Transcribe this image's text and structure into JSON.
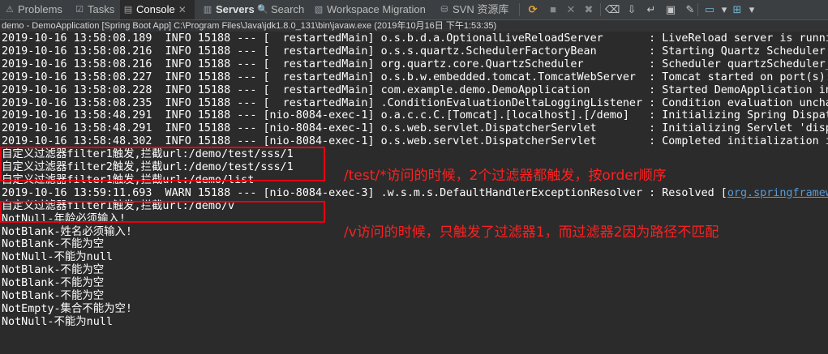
{
  "tabs": [
    {
      "label": "Problems",
      "icon": "problems-icon",
      "glyph": "⚠",
      "active": false
    },
    {
      "label": "Tasks",
      "icon": "tasks-icon",
      "glyph": "☑",
      "active": false
    },
    {
      "label": "Console",
      "icon": "console-icon",
      "glyph": "▤",
      "active": true,
      "close": "✕"
    },
    {
      "label": "Servers",
      "icon": "servers-icon",
      "glyph": "▥",
      "active": false,
      "bold": true
    },
    {
      "label": "Search",
      "icon": "search-icon",
      "glyph": "🔍",
      "active": false
    },
    {
      "label": "Workspace Migration",
      "icon": "workspace-migration-icon",
      "glyph": "▧",
      "active": false
    },
    {
      "label": "SVN 资源库",
      "icon": "svn-icon",
      "glyph": "⛁",
      "active": false
    }
  ],
  "toolbar": [
    {
      "name": "refresh-icon",
      "glyph": "⟳",
      "style": "orange"
    },
    {
      "name": "terminate-icon",
      "glyph": "■",
      "style": "gray"
    },
    {
      "name": "remove-launch-icon",
      "glyph": "✕",
      "style": "gray"
    },
    {
      "name": "remove-all-terminated-icon",
      "glyph": "✖",
      "style": "gray"
    },
    {
      "name": "clear-console-icon",
      "glyph": "⌫",
      "style": ""
    },
    {
      "name": "scroll-lock-icon",
      "glyph": "⇩",
      "style": ""
    },
    {
      "name": "word-wrap-icon",
      "glyph": "↵",
      "style": ""
    },
    {
      "name": "show-on-output-icon",
      "glyph": "▣",
      "style": ""
    },
    {
      "name": "pin-console-icon",
      "glyph": "✎",
      "style": ""
    },
    {
      "name": "display-selected-console-icon",
      "glyph": "▭",
      "style": "teal"
    },
    {
      "name": "display-selected-console-dropdown-icon",
      "glyph": "▾",
      "style": ""
    },
    {
      "name": "open-console-icon",
      "glyph": "⊞",
      "style": "teal"
    },
    {
      "name": "open-console-dropdown-icon",
      "glyph": "▾",
      "style": ""
    }
  ],
  "launch_info": "demo - DemoApplication [Spring Boot App] C:\\Program Files\\Java\\jdk1.8.0_131\\bin\\javaw.exe (2019年10月16日 下午1:53:35)",
  "console_lines": [
    {
      "text": "2019-10-16 13:58:08.189  INFO 15188 --- [  restartedMain] o.s.b.d.a.OptionalLiveReloadServer       : LiveReload server is runni"
    },
    {
      "text": "2019-10-16 13:58:08.216  INFO 15188 --- [  restartedMain] o.s.s.quartz.SchedulerFactoryBean        : Starting Quartz Scheduler "
    },
    {
      "text": "2019-10-16 13:58:08.216  INFO 15188 --- [  restartedMain] org.quartz.core.QuartzScheduler          : Scheduler quartzScheduler_"
    },
    {
      "text": "2019-10-16 13:58:08.227  INFO 15188 --- [  restartedMain] o.s.b.w.embedded.tomcat.TomcatWebServer  : Tomcat started on port(s):"
    },
    {
      "text": "2019-10-16 13:58:08.228  INFO 15188 --- [  restartedMain] com.example.demo.DemoApplication         : Started DemoApplication in"
    },
    {
      "text": "2019-10-16 13:58:08.235  INFO 15188 --- [  restartedMain] .ConditionEvaluationDeltaLoggingListener : Condition evaluation uncha"
    },
    {
      "text": "2019-10-16 13:58:48.291  INFO 15188 --- [nio-8084-exec-1] o.a.c.c.C.[Tomcat].[localhost].[/demo]   : Initializing Spring Dispat"
    },
    {
      "text": "2019-10-16 13:58:48.291  INFO 15188 --- [nio-8084-exec-1] o.s.web.servlet.DispatcherServlet        : Initializing Servlet 'disp"
    },
    {
      "text": "2019-10-16 13:58:48.302  INFO 15188 --- [nio-8084-exec-1] o.s.web.servlet.DispatcherServlet        : Completed initialization i"
    },
    {
      "text": "自定义过滤器filter1触发,拦截url:/demo/test/sss/1"
    },
    {
      "text": "自定义过滤器filter2触发,拦截url:/demo/test/sss/1"
    },
    {
      "text": "自定义过滤器filter1触发,拦截url:/demo/list"
    },
    {
      "text": "2019-10-16 13:59:11.693  WARN 15188 --- [nio-8084-exec-3] .w.s.m.s.DefaultHandlerExceptionResolver : Resolved [",
      "link": "org.springframew"
    },
    {
      "text": "自定义过滤器filter1触发,拦截url:/demo/v"
    },
    {
      "text": "NotNull-年龄必须输入!"
    },
    {
      "text": "NotBlank-姓名必须输入!"
    },
    {
      "text": "NotBlank-不能为空"
    },
    {
      "text": "NotNull-不能为null"
    },
    {
      "text": "NotBlank-不能为空"
    },
    {
      "text": "NotBlank-不能为空"
    },
    {
      "text": "NotBlank-不能为空"
    },
    {
      "text": "NotEmpty-集合不能为空!"
    },
    {
      "text": "NotNull-不能为null"
    }
  ],
  "annotations": [
    {
      "text": "/test/*访问的时候，2个过滤器都触发，按order顺序"
    },
    {
      "text": "/v访问的时候，只触发了过滤器1，而过滤器2因为路径不匹配"
    }
  ],
  "colors": {
    "highlight": "#e60012",
    "annotation": "#ff2020",
    "link": "#5a9bd6"
  }
}
